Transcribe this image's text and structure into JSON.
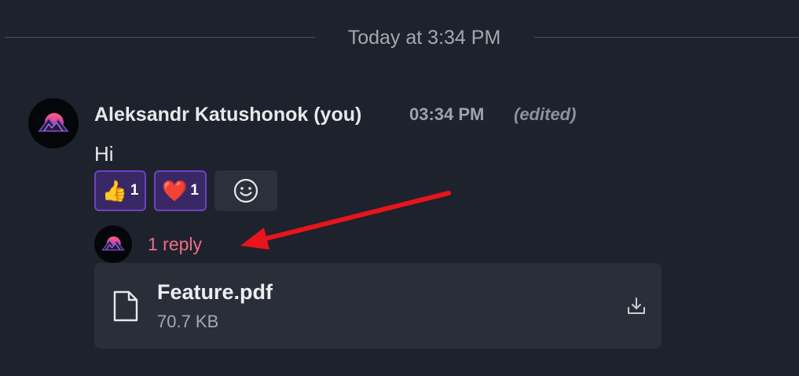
{
  "divider": {
    "label": "Today at 3:34 PM"
  },
  "message": {
    "author": "Aleksandr Katushonok (you)",
    "time": "03:34 PM",
    "edited_label": "(edited)",
    "text": "Hi",
    "reactions": [
      {
        "emoji": "👍",
        "icon": "thumbs-up-icon",
        "count": "1"
      },
      {
        "emoji": "❤️",
        "icon": "heart-icon",
        "count": "1"
      }
    ],
    "add_reaction_icon": "smiley-face-icon",
    "reply_label": "1 reply"
  },
  "attachment": {
    "name": "Feature.pdf",
    "size": "70.7 KB",
    "icon": "file-icon",
    "action_icon": "download-icon"
  },
  "colors": {
    "background": "#1e222c",
    "reply_link": "#ee6e86",
    "reaction_active_bg": "#3a2766",
    "reaction_active_border": "#6b43c2",
    "annotation_arrow": "#e8141c"
  }
}
